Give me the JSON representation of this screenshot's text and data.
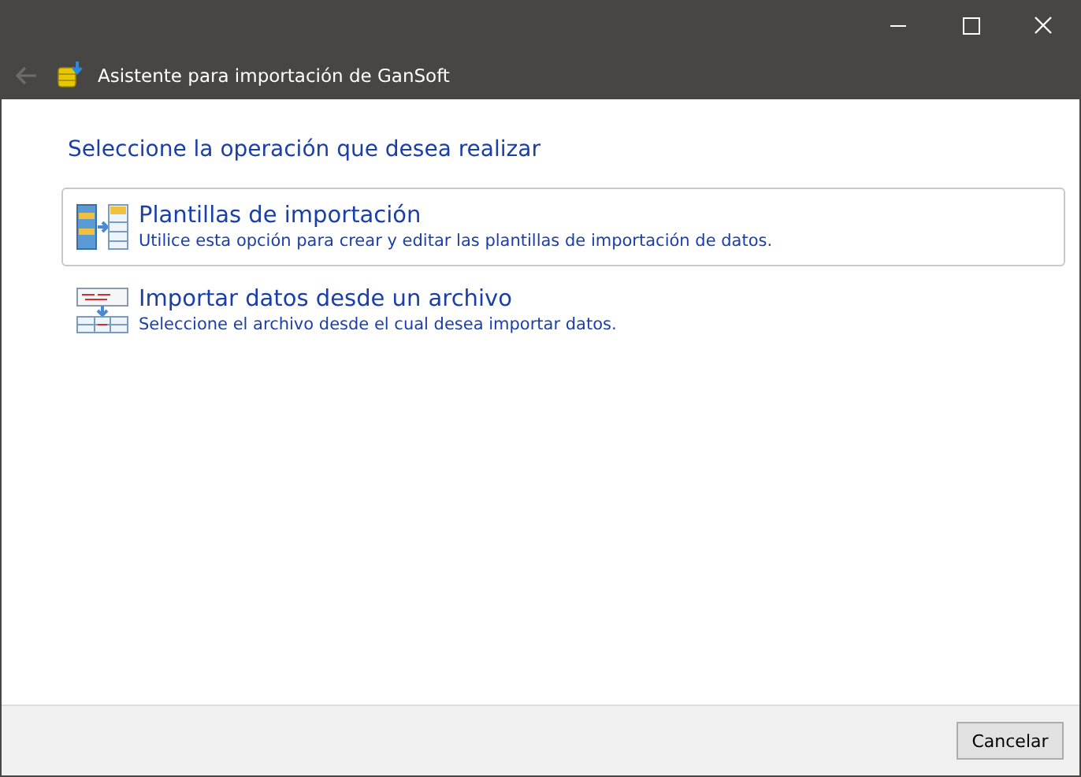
{
  "window": {
    "title": "Asistente para importación de GanSoft"
  },
  "heading": "Seleccione la operación que desea realizar",
  "options": [
    {
      "kind": "templates",
      "title": "Plantillas de importación",
      "description": "Utilice esta opción para crear y editar las plantillas de importación de datos.",
      "selected": true
    },
    {
      "kind": "import",
      "title": "Importar datos desde un archivo",
      "description": "Seleccione el archivo desde el cual desea importar datos.",
      "selected": false
    }
  ],
  "buttons": [
    {
      "label": "Cancelar"
    }
  ]
}
